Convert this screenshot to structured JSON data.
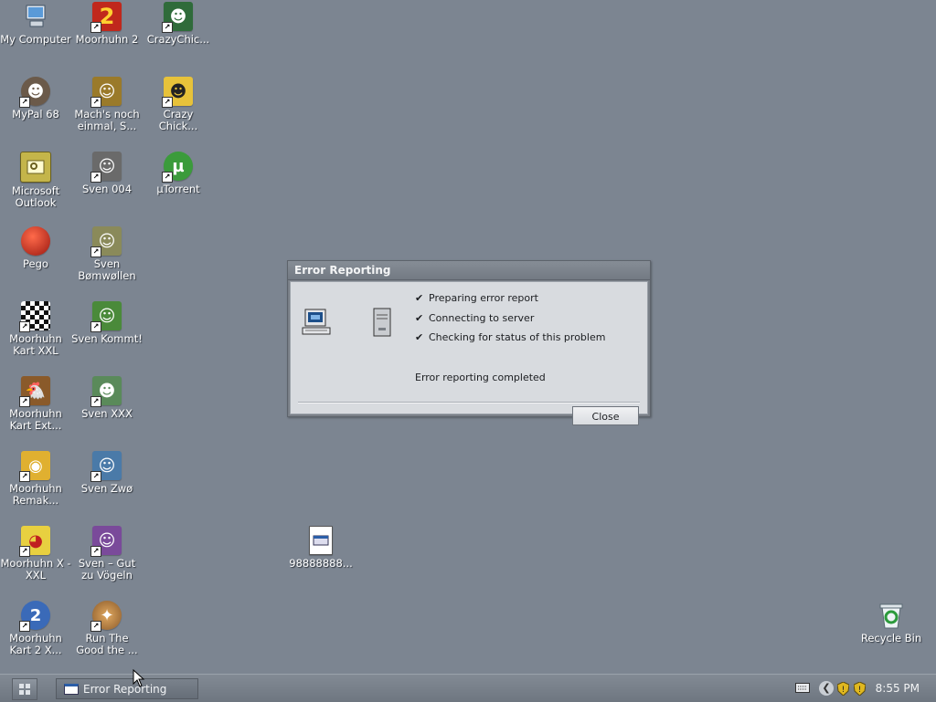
{
  "desktop": {
    "icons": [
      {
        "label": "My Computer",
        "glyph": "computer-icon",
        "color": "#3a78c8"
      },
      {
        "label": "Moorhuhn 2",
        "glyph": "2",
        "color": "#c0281c"
      },
      {
        "label": "CrazyChic...",
        "glyph": "chicken-icon",
        "color": "#2f6b3a"
      },
      {
        "label": "MyPal 68",
        "glyph": "raccoon-icon",
        "color": "#6b5a4a"
      },
      {
        "label": "Mach's noch einmal, S...",
        "glyph": "moose-icon",
        "color": "#9a7a2a"
      },
      {
        "label": "Crazy Chick...",
        "glyph": "chicken-icon",
        "color": "#e7c23a"
      },
      {
        "label": "Microsoft Outlook",
        "glyph": "outlook-icon",
        "color": "#b7a73a"
      },
      {
        "label": "Sven 004",
        "glyph": "sheep-icon",
        "color": "#6a6a6a"
      },
      {
        "label": "µTorrent",
        "glyph": "µ",
        "color": "#3b9b3b"
      },
      {
        "label": "Pego",
        "glyph": "ball-icon",
        "color": "#b5261b"
      },
      {
        "label": "Sven Bømwøllen",
        "glyph": "sheep-icon",
        "color": "#7a7a5a"
      },
      {
        "label": "Moorhuhn Kart XXL",
        "glyph": "flag-icon",
        "color": "#222222"
      },
      {
        "label": "Sven Kommt!",
        "glyph": "sheep-icon",
        "color": "#4a8a3a"
      },
      {
        "label": "Moorhuhn Kart Ext...",
        "glyph": "chicken-icon",
        "color": "#8a5a2a"
      },
      {
        "label": "Sven XXX",
        "glyph": "sheep-icon",
        "color": "#5a8a5a"
      },
      {
        "label": "Moorhuhn Remak...",
        "glyph": "chicken-icon",
        "color": "#d8a42a"
      },
      {
        "label": "Sven Zwø",
        "glyph": "sheep-icon",
        "color": "#4a7aa8"
      },
      {
        "label": "Moorhuhn X - XXL",
        "glyph": "chicken-icon",
        "color": "#d8c43a"
      },
      {
        "label": "Sven – Gut zu Vögeln",
        "glyph": "sheep-icon",
        "color": "#7a4a9a"
      },
      {
        "label": "Moorhuhn Kart 2 X...",
        "glyph": "2",
        "color": "#3a6ab8"
      },
      {
        "label": "Run The Good the ...",
        "glyph": "pie-icon",
        "color": "#a8763a"
      },
      {
        "label": "98888888...",
        "glyph": "file-icon",
        "color": "#ffffff"
      },
      {
        "label": "Recycle Bin",
        "glyph": "recycle-bin-icon",
        "color": "#3a9a4a"
      }
    ]
  },
  "dialog": {
    "title": "Error Reporting",
    "steps": [
      "Preparing error report",
      "Connecting to server",
      "Checking for status of this problem"
    ],
    "status": "Error reporting completed",
    "close_label": "Close"
  },
  "taskbar": {
    "task_label": "Error Reporting",
    "clock": "8:55 PM"
  }
}
